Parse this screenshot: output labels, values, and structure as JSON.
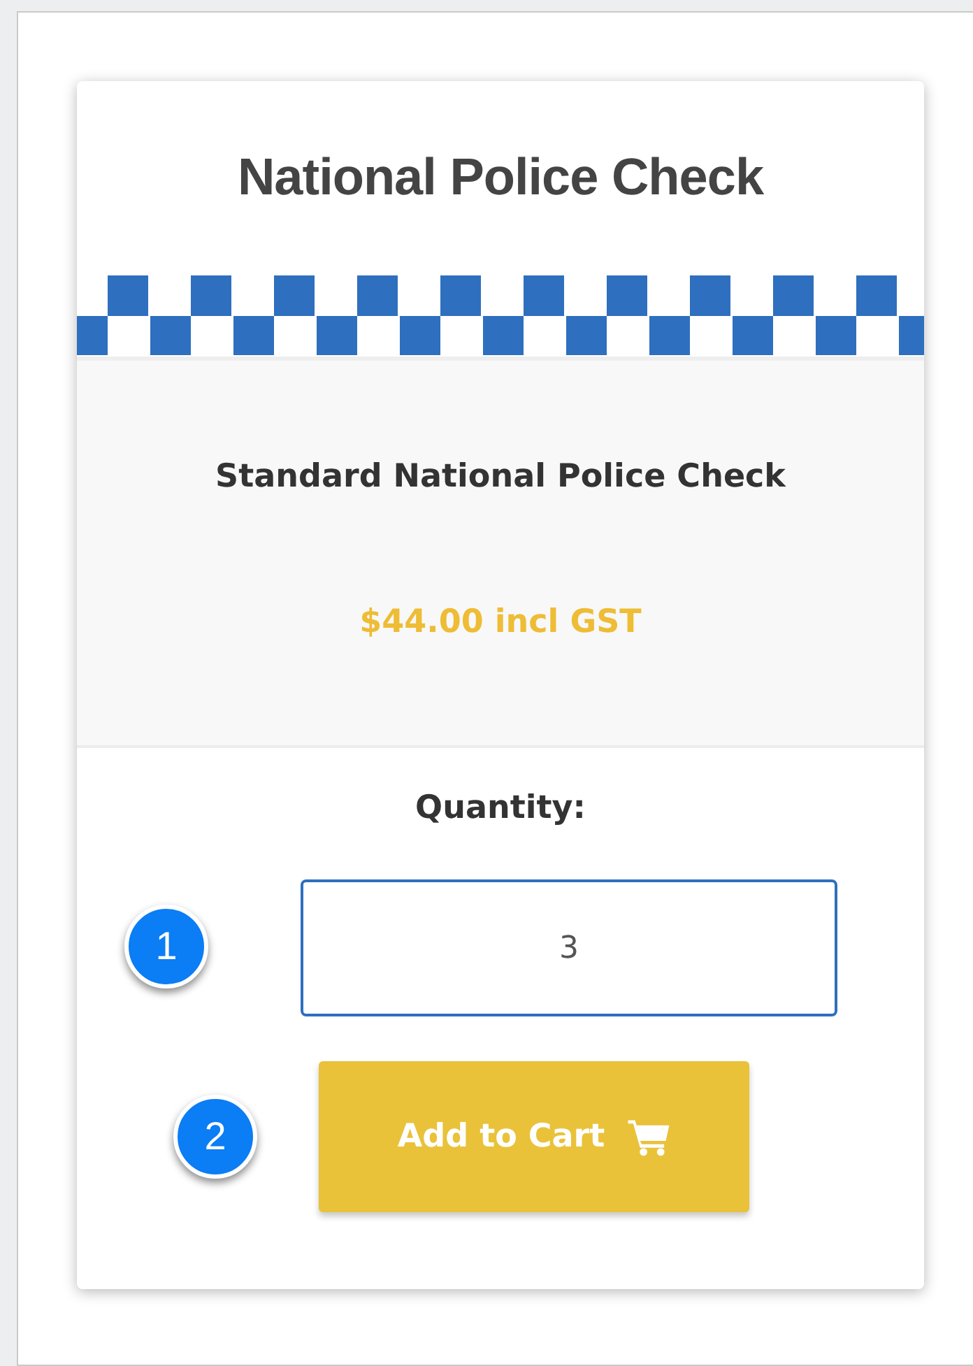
{
  "product": {
    "title": "National Police Check",
    "name": "Standard National Police Check",
    "price": "$44.00 incl GST"
  },
  "quantity": {
    "label": "Quantity:",
    "value": "3",
    "callout": "1"
  },
  "add_button": {
    "label": "Add to Cart",
    "callout": "2"
  }
}
